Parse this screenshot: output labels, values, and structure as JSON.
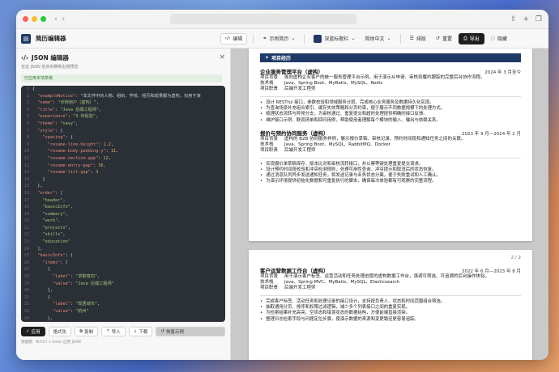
{
  "browser": {
    "url": "",
    "nav": [
      "‹",
      "›"
    ]
  },
  "toolbar": {
    "app_title": "简历编辑器",
    "edit": "编辑",
    "sample_resume": "示例简历",
    "theme": "深蓝标题栏",
    "language": "简体中文",
    "layout": "排版",
    "reset": "重置",
    "export": "导出",
    "hide": "隐藏"
  },
  "editor_panel": {
    "title": "JSON 编辑器",
    "subtitle": "在这 JSON 后实时刷新右侧预览",
    "status": "已应用本地草稿",
    "code_lines": [
      [
        "{",
        ""
      ],
      [
        "  \"exampleNotice\": \"本文件中的人物、组织、学校、经历和成果都为虚构，仅用于演",
        ""
      ],
      [
        "  \"name\": \"示例用户（虚构）\",",
        ""
      ],
      [
        "  \"title\": \"Java 后端工程师\",",
        ""
      ],
      [
        "  \"experience\": \"3 年经验\",",
        ""
      ],
      [
        "  \"theme\": \"navy\",",
        ""
      ],
      [
        "  \"style\": {",
        ""
      ],
      [
        "    \"spacing\": {",
        ""
      ],
      [
        "      \"resume-line-height\": 1.2,",
        ""
      ],
      [
        "      \"resume-body-padding-y\": 11,",
        ""
      ],
      [
        "      \"resume-section-gap\": 12,",
        ""
      ],
      [
        "      \"resume-entry-gap\": 16,",
        ""
      ],
      [
        "      \"resume-list-gap\": 3",
        ""
      ],
      [
        "    }",
        ""
      ],
      [
        "  },",
        ""
      ],
      [
        "  \"order\": [",
        ""
      ],
      [
        "    \"header\",",
        ""
      ],
      [
        "    \"basicInfo\",",
        ""
      ],
      [
        "    \"summary\",",
        ""
      ],
      [
        "    \"work\",",
        ""
      ],
      [
        "    \"projects\",",
        ""
      ],
      [
        "    \"skills\",",
        ""
      ],
      [
        "    \"education\"",
        ""
      ],
      [
        "  ],",
        ""
      ],
      [
        "  \"basicInfo\": {",
        ""
      ],
      [
        "    \"items\": [",
        ""
      ],
      [
        "      {",
        ""
      ],
      [
        "        \"label\": \"求职意向\",",
        ""
      ],
      [
        "        \"value\": \"Java 后端工程师\"",
        ""
      ],
      [
        "      },",
        ""
      ],
      [
        "      {",
        ""
      ],
      [
        "        \"label\": \"现居城市\",",
        ""
      ],
      [
        "        \"value\": \"杭州\"",
        ""
      ],
      [
        "      },",
        ""
      ]
    ],
    "apply": "应用",
    "format": "格式化",
    "copy": "复制",
    "import": "导入",
    "download": "下载",
    "restore": "恢复示例",
    "footer_hint": "快捷键：⌘/Ctrl + Enter 应用 JSON"
  },
  "preview": {
    "section_title": "项目经历",
    "page_indicator": "2 / 2",
    "projects_page1": [
      {
        "title": "企业服务管理平台（虚构）",
        "date": "2024 年 3 月至今",
        "rows": [
          {
            "k": "项目背景",
            "v": "面向虚构企业客户的统一服务管理平台示例，用于演示从申请、审核到履约跟踪的完整后台协作流程。"
          },
          {
            "k": "技术栈",
            "v": "Java、Spring Boot、MyBatis、MySQL、Redis"
          },
          {
            "k": "项目职责",
            "v": "后端开发工程师"
          }
        ],
        "bullets": [
          "设计 RESTful 接口，参数校验和领域服务分层，完成核心业务服务及数据持久化实现。",
          "为查询场景补充组合索引、缓存失效策略和分页约束，便于展示不同数据规模下的处理方式。",
          "梳理状态流转与异常分支，为审核通过、重复提交和超时处理提供明确的接口反馈。",
          "维护接口示例、联调清单和回归用例，帮助使用者理解每个模块的输入、输出与依赖关系。"
        ]
      },
      {
        "title": "报价与预约协同服务（虚构）",
        "date": "2023 年 9 月—2024 年 2 月",
        "rows": [
          {
            "k": "项目背景",
            "v": "虚构的 B2B 协同服务样例，展示报价草稿、审核记录、预约时间段和通知任务之间的关联。"
          },
          {
            "k": "技术栈",
            "v": "Java、Spring Boot、MySQL、RabbitMQ、Docker"
          },
          {
            "k": "项目职责",
            "v": "后端开发工程师"
          }
        ],
        "bullets": [
          "实现报价单草稿保存、版本比对和审核流转接口，并以幂等键处理重复提交请求。",
          "设计预约时间段校验和冲突检测规则，处理可用性查询、冲突提示和取消后的状态恢复。",
          "通过消息队列异步发送通知任务，将发送记录与业务状态分离，便于失败重试和人工确认。",
          "为演示环境提供初始化数据和可重复执行的脚本，确保每次体验都有可观察的完整流程。"
        ]
      }
    ],
    "projects_page2": [
      {
        "title": "客户运营数据工作台（虚构）",
        "date": "2022 年 6 月—2023 年 8 月",
        "rows": [
          {
            "k": "项目背景",
            "v": "用于演示客户标签、运营活动和任务处理进度的虚构数据工作台，强调可筛选、可追溯的后台操作体验。"
          },
          {
            "k": "技术栈",
            "v": "Java、Spring MVC、MyBatis、MySQL、Elasticsearch"
          },
          {
            "k": "项目职责",
            "v": "后端开发工程师"
          }
        ],
        "bullets": [
          "完成客户标签、活动任务和处理记录的接口设计，支持按负责人、状态和时间范围组合筛选。",
          "抽取通用分页、排序和权限过滤逻辑，减少多个列表接口之间的重复实现。",
          "为检索结果补充高亮、空状态和错误状态的数据结构，方便前端直接渲染。",
          "整理日志检索字段与问题定位步骤，使演示数据的来源和变更路径更容易追踪。"
        ]
      }
    ]
  }
}
